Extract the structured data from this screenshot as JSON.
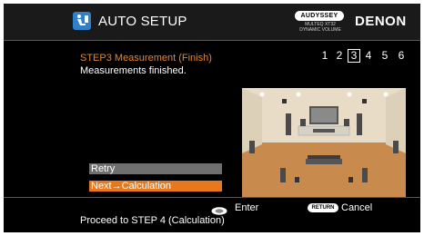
{
  "header": {
    "title": "AUTO SETUP",
    "icon": "auto-setup-icon",
    "audyssey_logo": "AUDYSSEY",
    "audyssey_sub1": "MULTEQ XT32",
    "audyssey_sub2": "DYNAMIC VOLUME",
    "brand": "DENON"
  },
  "step": {
    "title": "STEP3 Measurement (Finish)",
    "message": "Measurements finished.",
    "numbers": [
      "1",
      "2",
      "3",
      "4",
      "5",
      "6"
    ],
    "active_index": 2
  },
  "actions": {
    "retry_label": "Retry",
    "next_label": "Next→Calculation"
  },
  "footer": {
    "enter_label": "Enter",
    "return_badge": "RETURN",
    "cancel_label": "Cancel",
    "description": "Proceed to STEP 4 (Calculation)"
  },
  "colors": {
    "accent": "#e8781e",
    "step_title": "#e8852a",
    "icon_blue": "#2f7fc9",
    "button_gray": "#6f6f6f",
    "room_wall": "#e9dcc7",
    "room_floor": "#c98a4e"
  }
}
